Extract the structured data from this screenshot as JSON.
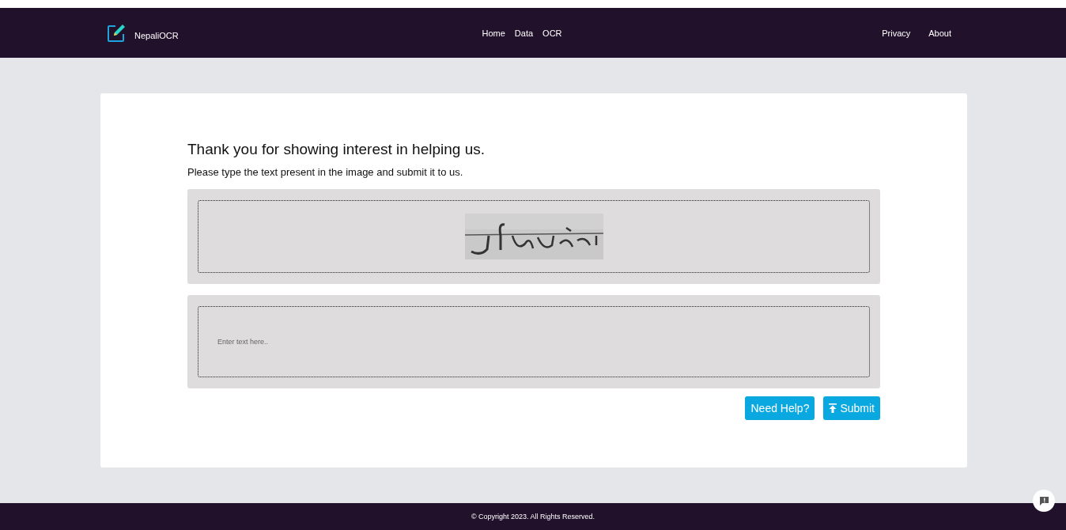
{
  "brand": {
    "name": "NepaliOCR"
  },
  "nav_center": [
    {
      "label": "Home"
    },
    {
      "label": "Data"
    },
    {
      "label": "OCR"
    }
  ],
  "nav_right": [
    {
      "label": "Privacy"
    },
    {
      "label": "About"
    }
  ],
  "heading": "Thank you for showing interest in helping us.",
  "instruction": "Please type the text present in the image and submit it to us.",
  "answer": {
    "placeholder": "Enter text here.."
  },
  "buttons": [
    {
      "label": "Need Help?",
      "kind": "help"
    },
    {
      "label": "Submit",
      "kind": "submit"
    }
  ],
  "footer": "© Copyright 2023. All Rights Reserved."
}
